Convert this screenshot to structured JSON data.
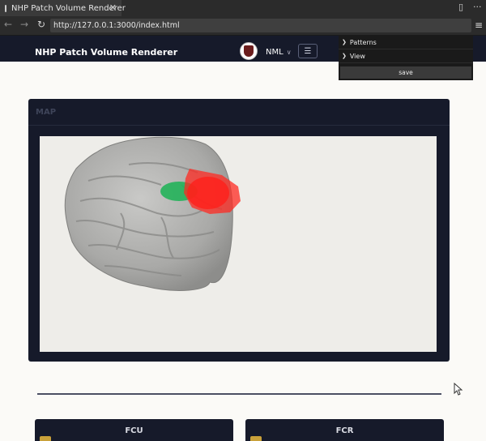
{
  "browser": {
    "tab_title": "NHP Patch Volume Renderer",
    "tab_close": "✕",
    "url": "http://127.0.0.1:3000/index.html"
  },
  "app": {
    "title": "NHP Patch Volume Renderer",
    "user_label": "NML",
    "menu_icon": "hamburger-icon"
  },
  "gui": {
    "folders": [
      "Patterns",
      "View"
    ],
    "save_label": "save"
  },
  "map_card": {
    "title": "MAP"
  },
  "cards": [
    {
      "title": "FCU"
    },
    {
      "title": "FCR"
    }
  ],
  "colors": {
    "header_bg": "#161a2a",
    "page_bg": "#fbfaf7",
    "viewport_bg": "#eeede9",
    "patch_red": "#ff2a22",
    "patch_green": "#23b35a",
    "badge": "#c9a13a"
  }
}
